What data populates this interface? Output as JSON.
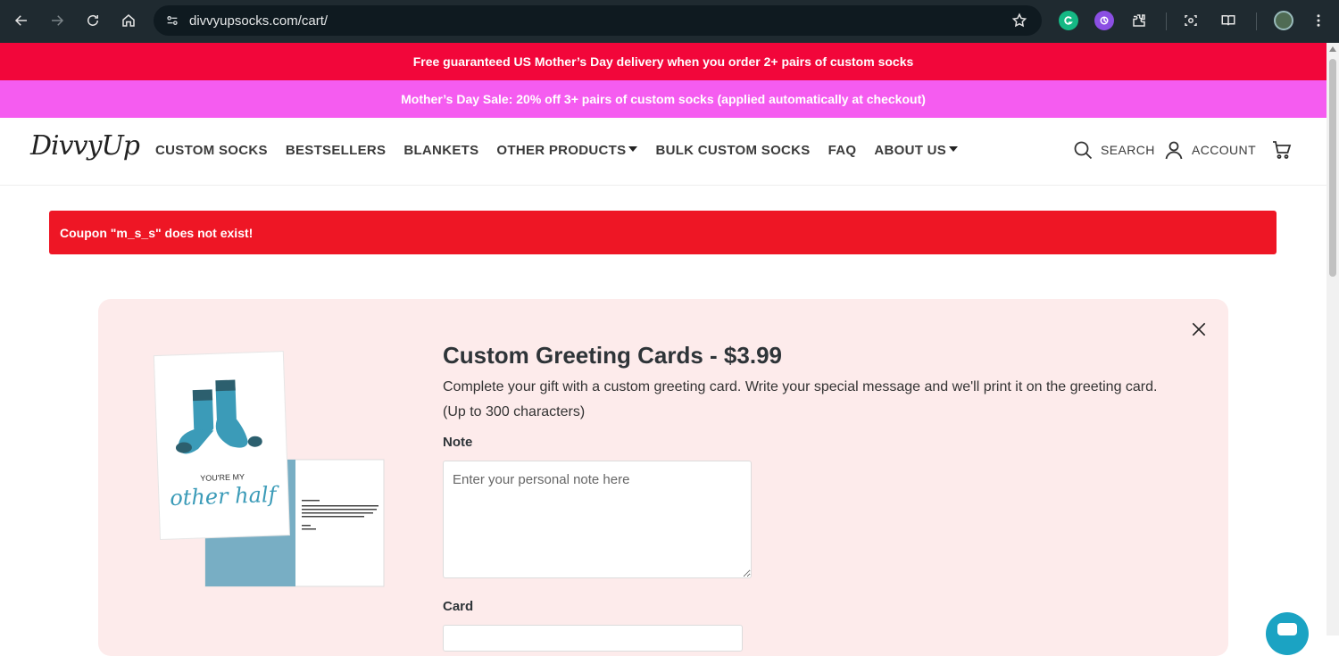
{
  "browser": {
    "url": "divvyupsocks.com/cart/"
  },
  "promo": {
    "line1": "Free guaranteed US Mother’s Day delivery when you order 2+ pairs of custom socks",
    "line2": "Mother’s Day Sale: 20% off 3+ pairs of custom socks (applied automatically at checkout)"
  },
  "header": {
    "logo": "DivvyUp",
    "menu": [
      {
        "label": "CUSTOM SOCKS"
      },
      {
        "label": "BESTSELLERS"
      },
      {
        "label": "BLANKETS"
      },
      {
        "label": "OTHER PRODUCTS",
        "dropdown": true
      },
      {
        "label": "BULK CUSTOM SOCKS"
      },
      {
        "label": "FAQ"
      },
      {
        "label": "ABOUT US",
        "dropdown": true
      }
    ],
    "search_label": "SEARCH",
    "account_label": "ACCOUNT"
  },
  "alert": {
    "message": "Coupon \"m_s_s\" does not exist!"
  },
  "greeting_card": {
    "title": "Custom Greeting Cards - $3.99",
    "description": "Complete your gift with a custom greeting card. Write your special message and we'll print it on the greeting card. (Up to 300 characters)",
    "note_label": "Note",
    "note_placeholder": "Enter your personal note here",
    "card_label": "Card",
    "card_text_line1": "YOU'RE MY",
    "card_text_line2": "other half"
  },
  "colors": {
    "promo1": "#f2063a",
    "promo2": "#f55cf0",
    "alert": "#ee1625",
    "panel": "#fdebeb",
    "accent_teal": "#1ba3c3"
  }
}
